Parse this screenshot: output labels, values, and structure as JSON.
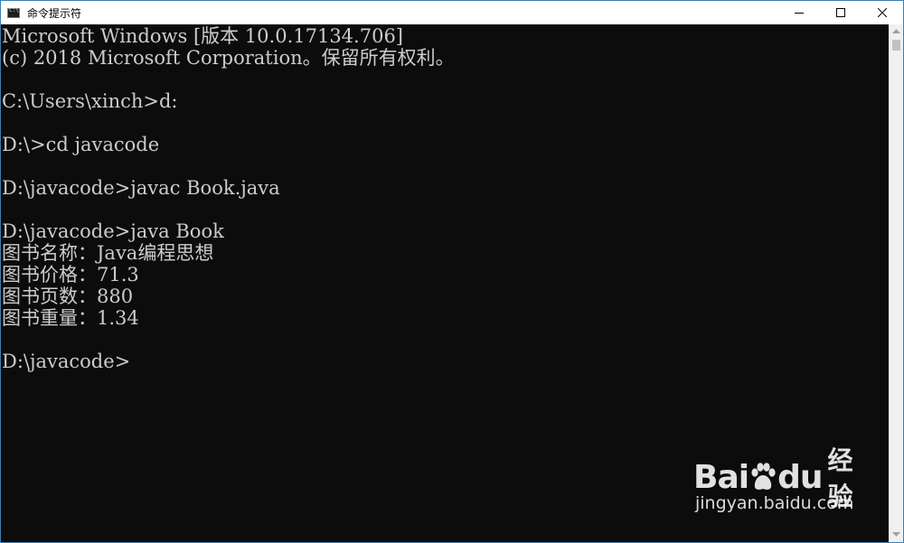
{
  "window": {
    "title": "命令提示符"
  },
  "console": {
    "lines": [
      "Microsoft Windows [版本 10.0.17134.706]",
      "(c) 2018 Microsoft Corporation。保留所有权利。",
      "",
      "C:\\Users\\xinch>d:",
      "",
      "D:\\>cd javacode",
      "",
      "D:\\javacode>javac Book.java",
      "",
      "D:\\javacode>java Book",
      "图书名称：Java编程思想",
      "图书价格：71.3",
      "图书页数：880",
      "图书重量：1.34",
      "",
      "D:\\javacode>"
    ]
  },
  "watermark": {
    "logo_left": "Bai",
    "logo_right": "du",
    "logo_cn": "经验",
    "url": "jingyan.baidu.com"
  },
  "icons": {
    "app": "cmd-app-icon",
    "minimize": "minimize-icon",
    "maximize": "maximize-icon",
    "close": "close-icon"
  }
}
